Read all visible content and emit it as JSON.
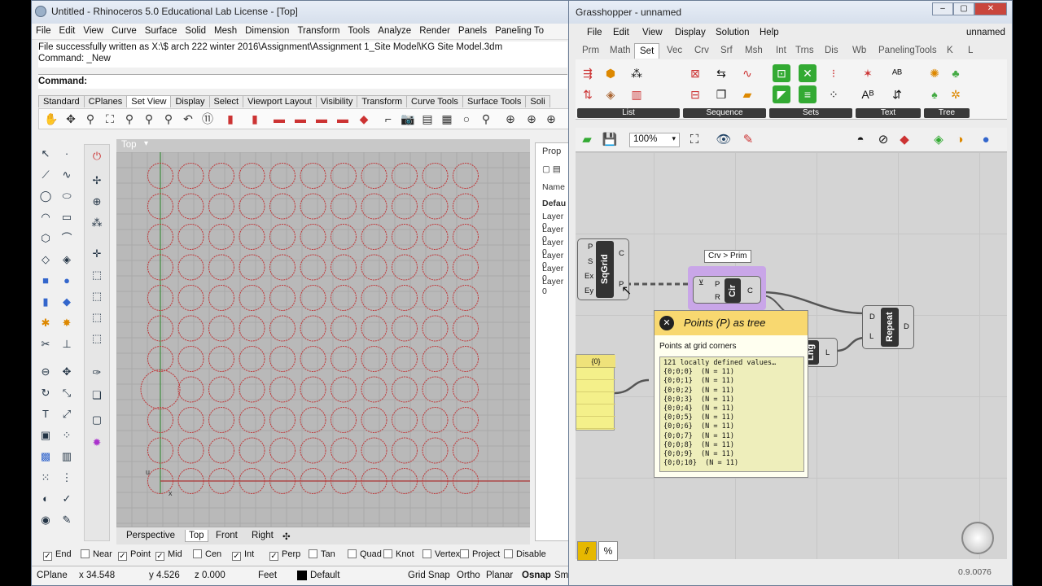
{
  "rhino": {
    "title": "Untitled - Rhinoceros 5.0 Educational Lab License - [Top]",
    "menu": [
      "File",
      "Edit",
      "View",
      "Curve",
      "Surface",
      "Solid",
      "Mesh",
      "Dimension",
      "Transform",
      "Tools",
      "Analyze",
      "Render",
      "Panels",
      "Paneling To"
    ],
    "history": [
      "File successfully written as X:\\$ arch 222 winter 2016\\Assignment\\Assignment 1_Site Model\\KG Site Model.3dm",
      "Command: _New"
    ],
    "command_label": "Command:",
    "toolbar_tabs": [
      "Standard",
      "CPlanes",
      "Set View",
      "Display",
      "Select",
      "Viewport Layout",
      "Visibility",
      "Transform",
      "Curve Tools",
      "Surface Tools",
      "Soli"
    ],
    "active_toolbar_tab": "Set View",
    "viewport": {
      "name": "Top",
      "axis_u": "u",
      "axis_x": "x",
      "grid_rows": 11,
      "grid_cols": 11
    },
    "viewport_tabs": [
      "Perspective",
      "Top",
      "Front",
      "Right"
    ],
    "active_viewport_tab": "Top",
    "properties": {
      "tab": "Prop",
      "header": "Name",
      "default_item": "Defau",
      "items": [
        "Layer 0",
        "Layer 0",
        "Layer 0",
        "Layer 0",
        "Layer 0",
        "Layer 0"
      ]
    },
    "osnaps": [
      {
        "label": "End",
        "checked": true
      },
      {
        "label": "Near",
        "checked": false
      },
      {
        "label": "Point",
        "checked": true
      },
      {
        "label": "Mid",
        "checked": true
      },
      {
        "label": "Cen",
        "checked": false
      },
      {
        "label": "Int",
        "checked": true
      },
      {
        "label": "Perp",
        "checked": true
      },
      {
        "label": "Tan",
        "checked": false
      },
      {
        "label": "Quad",
        "checked": false
      },
      {
        "label": "Knot",
        "checked": false
      },
      {
        "label": "Vertex",
        "checked": false
      },
      {
        "label": "Project",
        "checked": false
      },
      {
        "label": "Disable",
        "checked": false
      }
    ],
    "status": {
      "cplane": "CPlane",
      "x": "x 34.548",
      "y": "y 4.526",
      "z": "z 0.000",
      "units": "Feet",
      "layer": "Default",
      "grid_snap": "Grid Snap",
      "ortho": "Ortho",
      "planar": "Planar",
      "osnap": "Osnap",
      "smarttrack": "Sm"
    }
  },
  "gh": {
    "title": "Grasshopper - unnamed",
    "doc_name": "unnamed",
    "menu": [
      "File",
      "Edit",
      "View",
      "Display",
      "Solution",
      "Help"
    ],
    "tabs": [
      "Prm",
      "Math",
      "Set",
      "Vec",
      "Crv",
      "Srf",
      "Msh",
      "Int",
      "Trns",
      "Dis",
      "Wb",
      "PanelingTools",
      "K",
      "L"
    ],
    "active_tab": "Set",
    "groups": [
      "List",
      "Sequence",
      "Sets",
      "Text",
      "Tree"
    ],
    "zoom": "100%",
    "components": {
      "sqgrid": {
        "name": "SqGrid",
        "inputs": [
          "P",
          "S",
          "Ex",
          "Ey"
        ],
        "outputs": [
          "C",
          "P"
        ]
      },
      "circle": {
        "name": "Cir",
        "inputs": [
          "P",
          "R"
        ],
        "outputs": [
          "C"
        ],
        "hint": "Crv > Prim"
      },
      "length": {
        "name": "Lng",
        "outputs": [
          "L"
        ]
      },
      "repeat": {
        "name": "Repeat",
        "inputs": [
          "D",
          "L"
        ],
        "outputs": [
          "D"
        ]
      },
      "panel": {
        "header": "{0}"
      }
    },
    "tooltip": {
      "title": "Points (P) as tree",
      "description": "Points at grid corners",
      "data": [
        "121 locally defined values…",
        "{0;0;0}  (N = 11)",
        "{0;0;1}  (N = 11)",
        "{0;0;2}  (N = 11)",
        "{0;0;3}  (N = 11)",
        "{0;0;4}  (N = 11)",
        "{0;0;5}  (N = 11)",
        "{0;0;6}  (N = 11)",
        "{0;0;7}  (N = 11)",
        "{0;0;8}  (N = 11)",
        "{0;0;9}  (N = 11)",
        "{0;0;10}  (N = 11)"
      ]
    },
    "version": "0.9.0076"
  },
  "colors": {
    "circle": "#c0393b",
    "grid_bg": "#b9b9b9",
    "selected_component": "#c9a6e8",
    "tooltip_header": "#f8d870"
  }
}
